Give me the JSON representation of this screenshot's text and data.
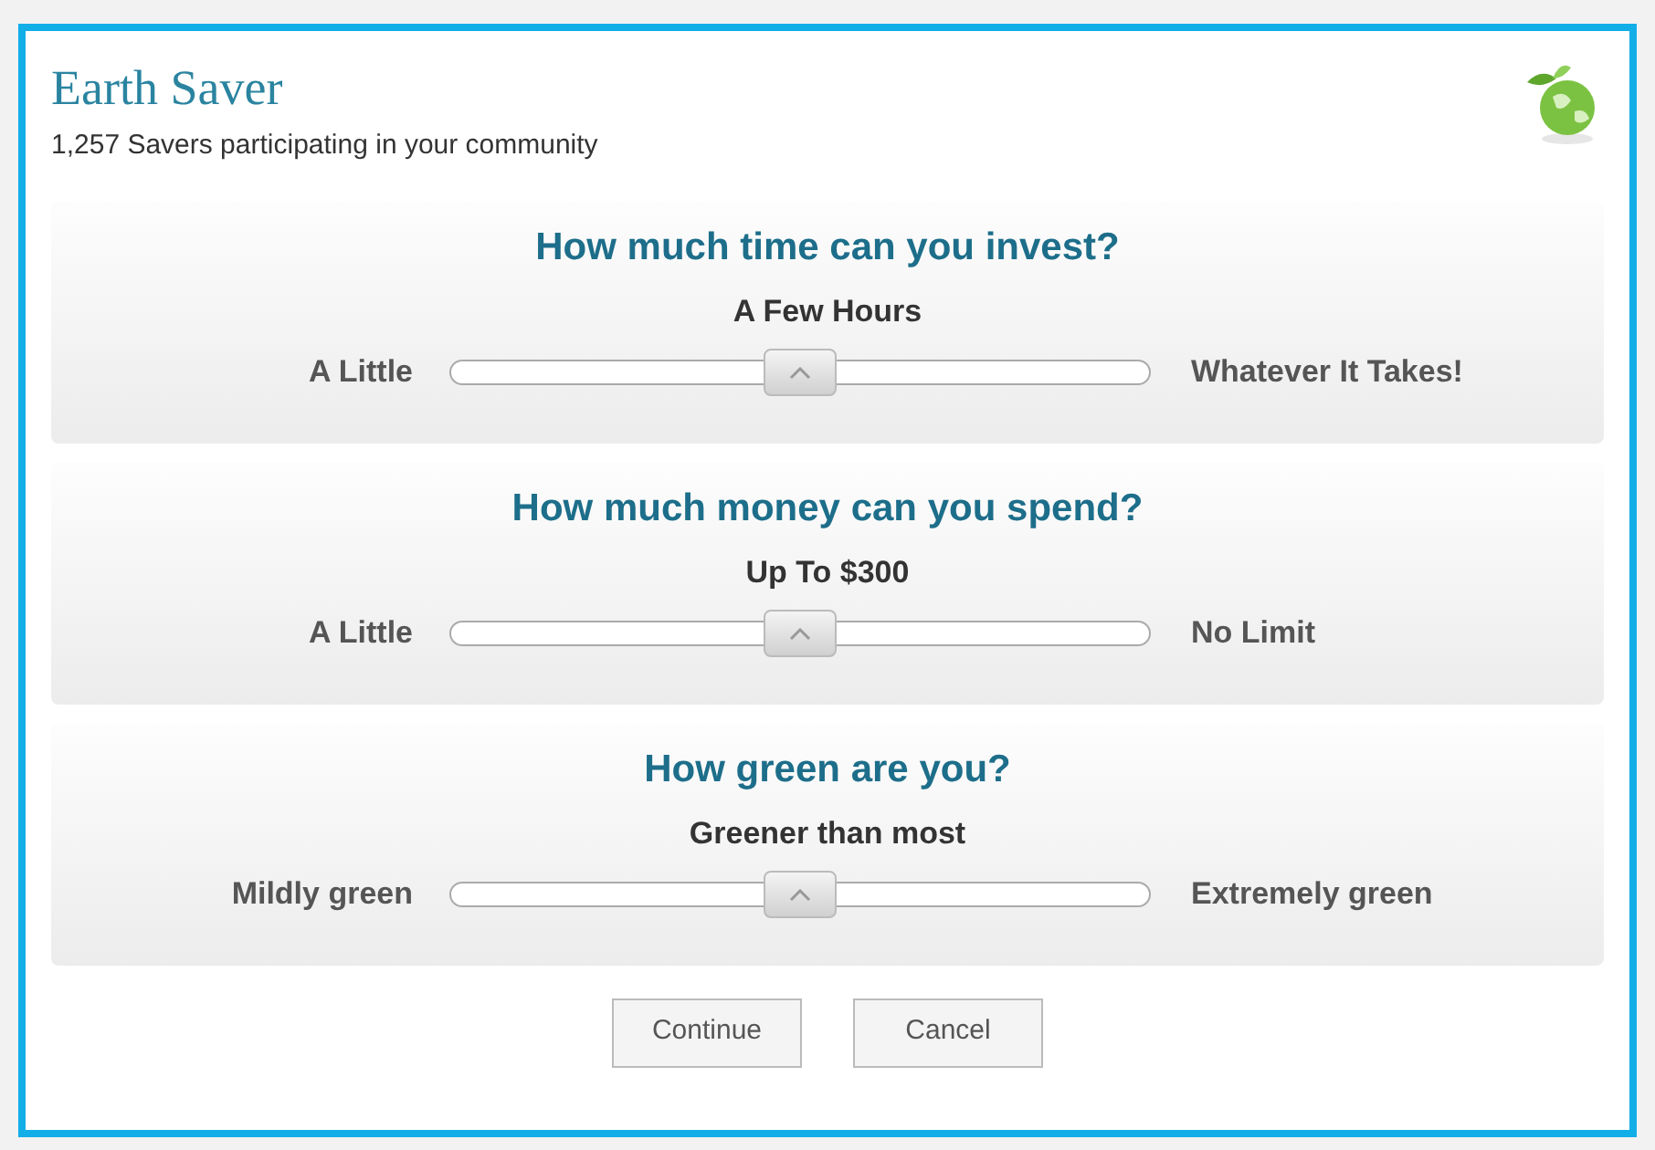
{
  "header": {
    "title": "Earth Saver",
    "subtitle": "1,257 Savers participating in your community"
  },
  "questions": [
    {
      "question": "How much time can you invest?",
      "answer": "A Few Hours",
      "min_label": "A Little",
      "max_label": "Whatever It Takes!",
      "level": 0.5
    },
    {
      "question": "How much money can you spend?",
      "answer": "Up To $300",
      "min_label": "A Little",
      "max_label": "No Limit",
      "level": 0.5
    },
    {
      "question": "How green are you?",
      "answer": "Greener than most",
      "min_label": "Mildly green",
      "max_label": "Extremely green",
      "level": 0.5
    }
  ],
  "buttons": [
    "Continue",
    "Cancel"
  ]
}
